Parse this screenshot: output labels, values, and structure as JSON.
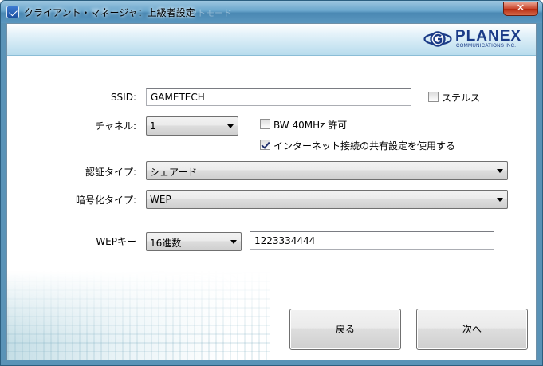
{
  "window": {
    "title": "クライアント・マネージャ：上級者設定",
    "title_ghost": "ントモード"
  },
  "brand": {
    "name": "PLANEX",
    "subtitle": "COMMUNICATIONS INC."
  },
  "form": {
    "ssid": {
      "label": "SSID:",
      "value": "GAMETECH"
    },
    "stealth": {
      "label": "ステルス",
      "checked": false
    },
    "channel": {
      "label": "チャネル:",
      "value": "1"
    },
    "bw40": {
      "label": "BW 40MHz 許可",
      "checked": false
    },
    "ics": {
      "label": "インターネット接続の共有設定を使用する",
      "checked": true
    },
    "auth_type": {
      "label": "認証タイプ:",
      "value": "シェアード"
    },
    "encryption_type": {
      "label": "暗号化タイプ:",
      "value": "WEP"
    },
    "wep_key": {
      "label": "WEPキー",
      "format": "16進数",
      "value": "1223334444"
    }
  },
  "buttons": {
    "back": "戻る",
    "next": "次へ"
  },
  "colors": {
    "title_bar": "#5a93b7",
    "brand_blue": "#1b3b87",
    "close_red": "#c9452b"
  }
}
